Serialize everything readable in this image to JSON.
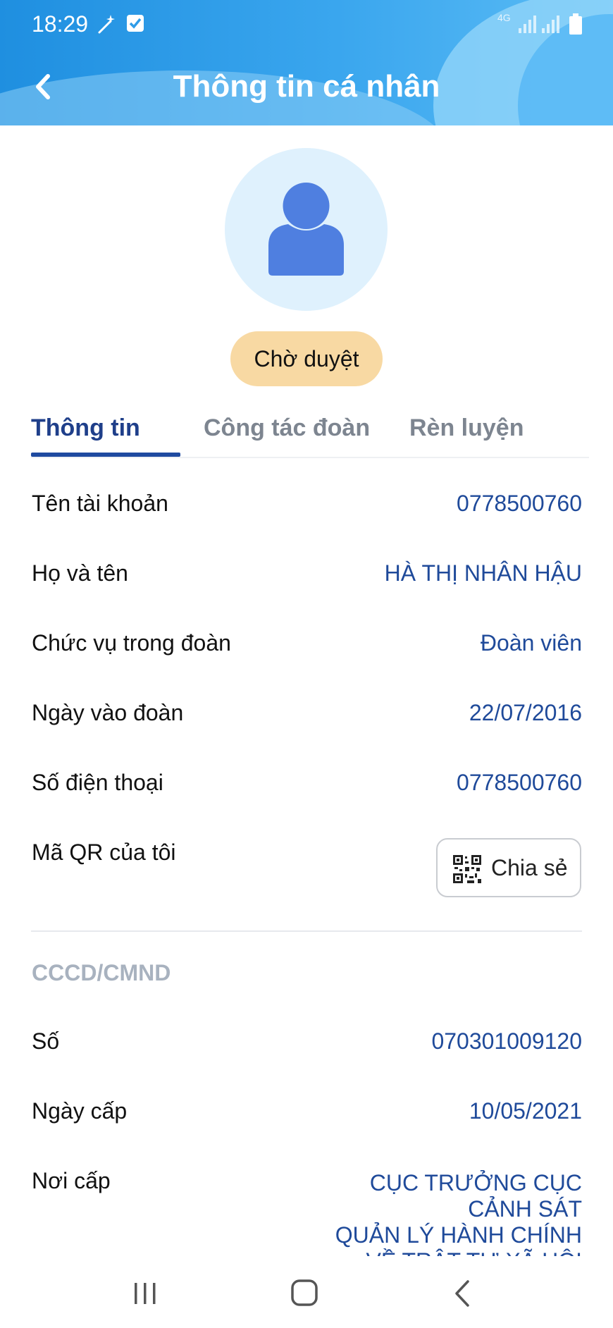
{
  "status_bar": {
    "time": "18:29",
    "network": "4G",
    "icons": [
      "magic-wand-icon",
      "checkbox-icon",
      "signal-icon",
      "signal-icon",
      "battery-icon"
    ]
  },
  "header": {
    "title": "Thông tin cá nhân",
    "back_icon": "chevron-left-icon"
  },
  "profile": {
    "avatar_icon": "user-icon",
    "status": "Chờ duyệt"
  },
  "tabs": [
    {
      "label": "Thông tin",
      "active": true
    },
    {
      "label": "Công tác đoàn",
      "active": false
    },
    {
      "label": "Rèn luyện",
      "active": false
    }
  ],
  "info": {
    "account_label": "Tên tài khoản",
    "account_value": "0778500760",
    "name_label": "Họ và tên",
    "name_value": "HÀ THỊ NHÂN HẬU",
    "position_label": "Chức vụ trong đoàn",
    "position_value": "Đoàn viên",
    "join_label": "Ngày vào đoàn",
    "join_value": "22/07/2016",
    "phone_label": "Số điện thoại",
    "phone_value": "0778500760",
    "qr_label": "Mã QR của tôi",
    "share_label": "Chia sẻ"
  },
  "id_card": {
    "section_title": "CCCD/CMND",
    "number_label": "Số",
    "number_value": "070301009120",
    "issue_date_label": "Ngày cấp",
    "issue_date_value": "10/05/2021",
    "place_label": "Nơi cấp",
    "place_lines": [
      "CỤC TRƯỞNG CỤC",
      "CẢNH SÁT",
      "QUẢN LÝ HÀNH CHÍNH",
      "VỀ TRẬT TỰ XÃ HỘI"
    ]
  },
  "colors": {
    "header_blue": "#2f9ce8",
    "value_blue": "#1f4a9a",
    "tab_active": "#1f3f8a",
    "pill_bg": "#f8d9a3",
    "avatar_bg": "#dff1fd",
    "avatar_icon": "#4f7fe0"
  },
  "navbar": {
    "icons": [
      "recent-apps-icon",
      "home-icon",
      "back-icon"
    ]
  }
}
